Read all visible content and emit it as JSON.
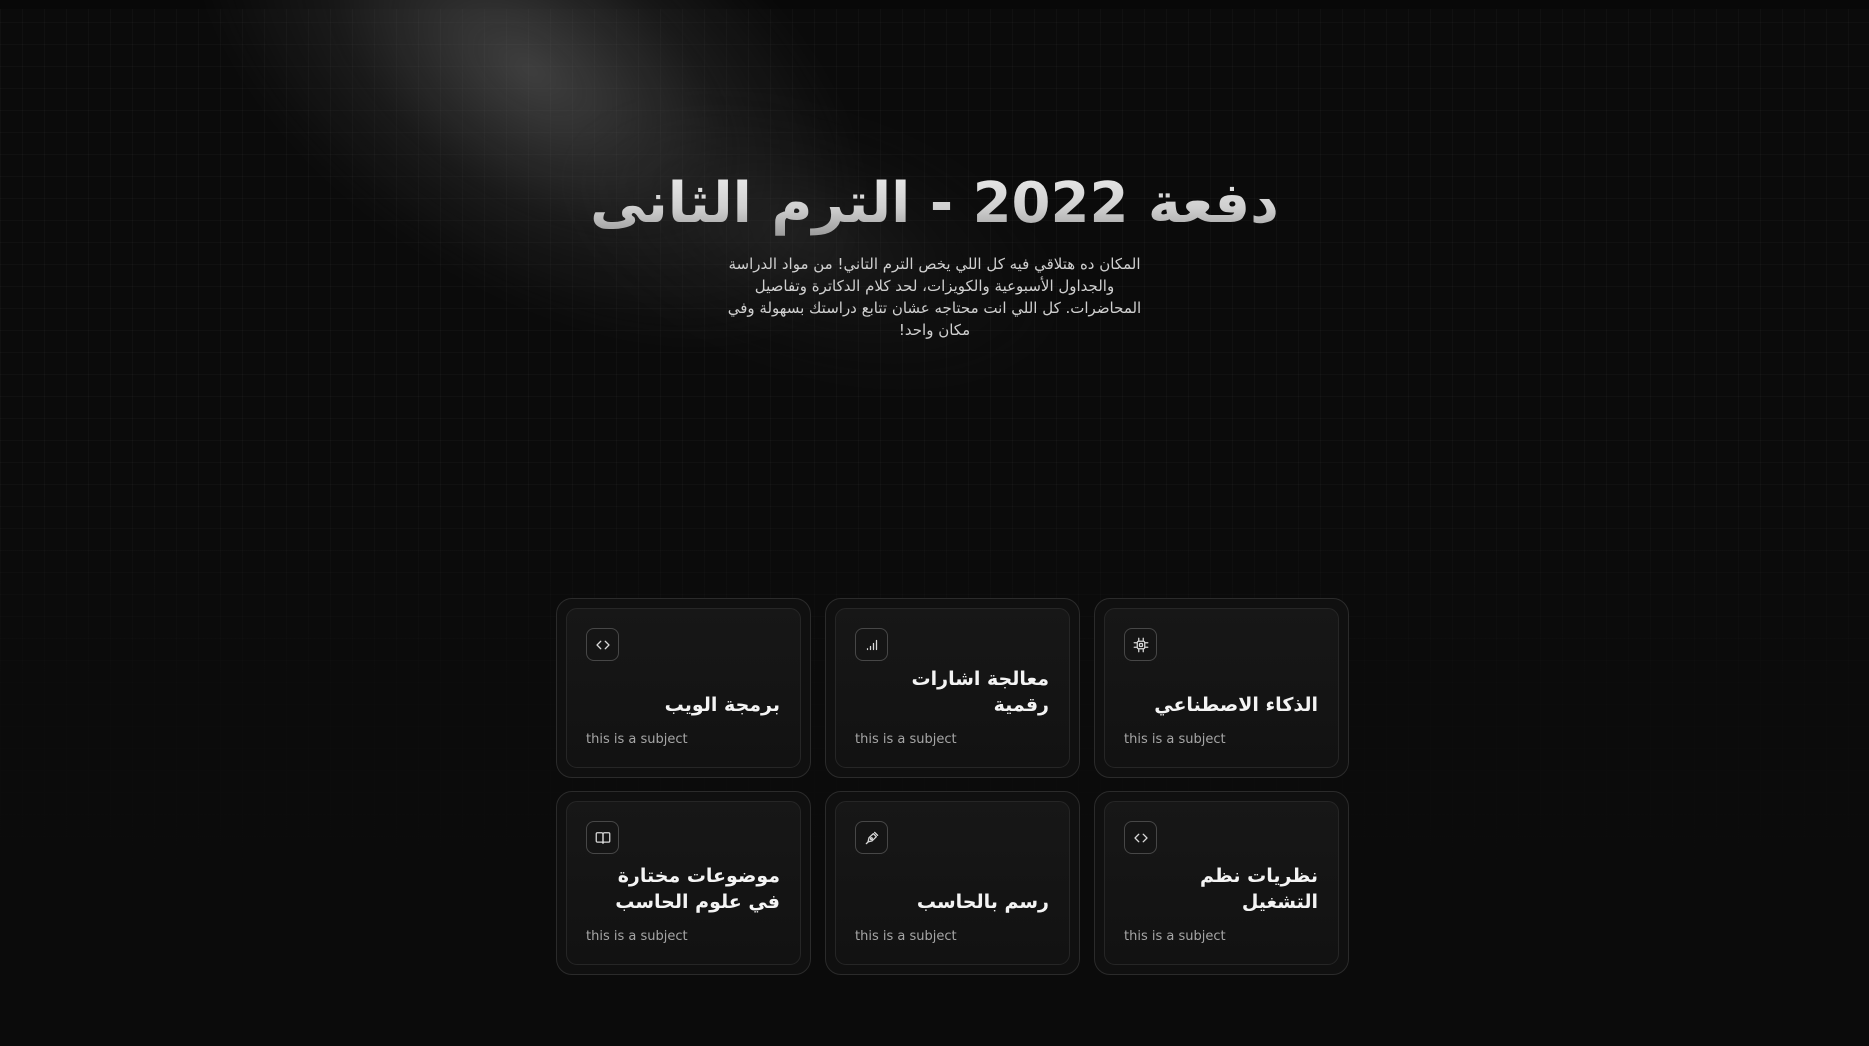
{
  "hero": {
    "title": "دفعة 2022 - الترم الثانى",
    "subtitle": "المكان ده هتلاقي فيه كل اللي يخص الترم التاني! من مواد الدراسة والجداول الأسبوعية والكويزات، لحد كلام الدكاترة وتفاصيل المحاضرات. كل اللي انت محتاجه عشان تتابع دراستك بسهولة وفي مكان واحد!"
  },
  "subjects": [
    {
      "title": "الذكاء الاصطناعي",
      "description": "this is a subject",
      "icon": "cpu-icon"
    },
    {
      "title": "معالجة اشارات رقمية",
      "description": "this is a subject",
      "icon": "signal-icon"
    },
    {
      "title": "برمجة الويب",
      "description": "this is a subject",
      "icon": "code-icon"
    },
    {
      "title": "نظريات نظم التشغيل",
      "description": "this is a subject",
      "icon": "code-icon"
    },
    {
      "title": "رسم بالحاسب",
      "description": "this is a subject",
      "icon": "pen-tool-icon"
    },
    {
      "title": "موضوعات مختارة في علوم الحاسب",
      "description": "this is a subject",
      "icon": "book-open-icon"
    }
  ]
}
